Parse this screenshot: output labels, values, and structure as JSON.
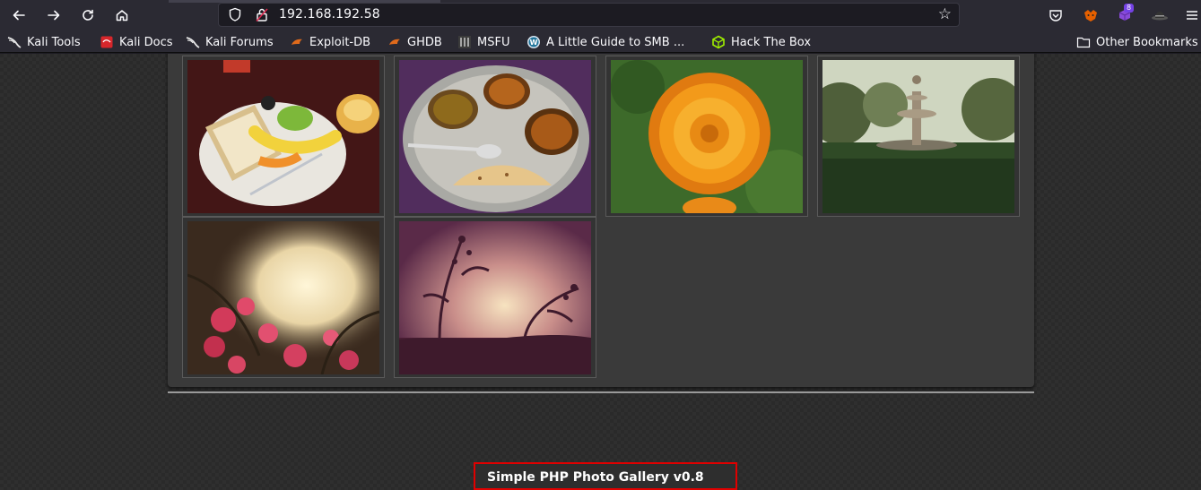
{
  "browser": {
    "url": "192.168.192.58",
    "nav": {
      "back_icon": "arrow-left-icon",
      "forward_icon": "arrow-right-icon",
      "reload_icon": "reload-icon",
      "home_icon": "home-icon"
    },
    "extension_badge": "8",
    "bookmarks": [
      {
        "label": "Kali Tools",
        "icon": "kali-dragon-icon"
      },
      {
        "label": "Kali Docs",
        "icon": "kali-docs-icon"
      },
      {
        "label": "Kali Forums",
        "icon": "kali-dragon-icon"
      },
      {
        "label": "Exploit-DB",
        "icon": "exploit-db-icon"
      },
      {
        "label": "GHDB",
        "icon": "ghdb-icon"
      },
      {
        "label": "MSFU",
        "icon": "msfu-icon"
      },
      {
        "label": "A Little Guide to SMB ...",
        "icon": "wordpress-icon"
      },
      {
        "label": "Hack The Box",
        "icon": "hackthebox-icon"
      }
    ],
    "other_bookmarks": "Other Bookmarks"
  },
  "gallery": {
    "photos": [
      {
        "subject": "breakfast-plate"
      },
      {
        "subject": "thali-plate"
      },
      {
        "subject": "orange-flower"
      },
      {
        "subject": "garden-fountain"
      },
      {
        "subject": "pink-flowers-sunset"
      },
      {
        "subject": "plant-silhouette-sunset"
      }
    ]
  },
  "footer": {
    "label": "Simple PHP Photo Gallery v0.8"
  },
  "colors": {
    "highlight_border": "#e00000",
    "toolbar_bg": "#2b2a33",
    "page_bg": "#2a2a2a",
    "panel_bg": "#3a3a3a"
  }
}
